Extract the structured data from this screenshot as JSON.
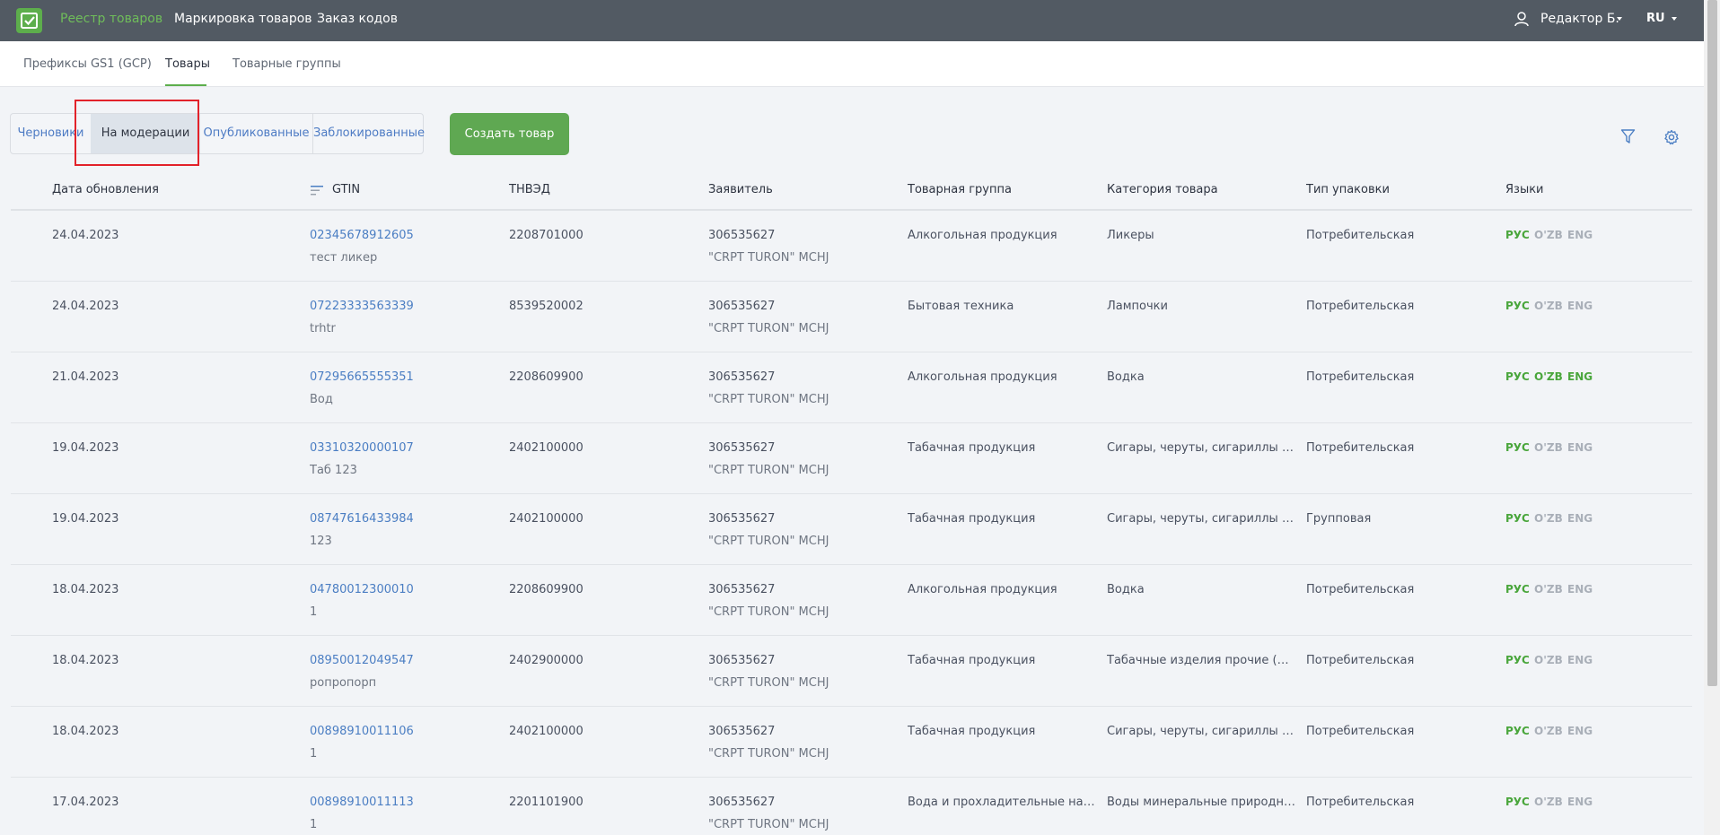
{
  "topbar": {
    "nav": [
      "Реестр товаров",
      "Маркировка товаров",
      "Заказ кодов"
    ],
    "user_name": "Редактор Б.",
    "language": "RU"
  },
  "subtabs": [
    "Префиксы GS1 (GCP)",
    "Товары",
    "Товарные группы"
  ],
  "filters": [
    "Черновики",
    "На модерации",
    "Опубликованные",
    "Заблокированные"
  ],
  "create_button": "Создать товар",
  "table": {
    "columns": [
      "Дата обновления",
      "GTIN",
      "ТНВЭД",
      "Заявитель",
      "Товарная группа",
      "Категория товара",
      "Тип упаковки",
      "Языки"
    ],
    "lang_labels": [
      "РУС",
      "O'ZB",
      "ENG"
    ],
    "rows": [
      {
        "date": "24.04.2023",
        "gtin": "02345678912605",
        "name": "тест ликер",
        "tnved": "2208701000",
        "inn": "306535627",
        "company": "\"CRPT TURON\" MCHJ",
        "group": "Алкогольная продукция",
        "category": "Ликеры",
        "package": "Потребительская",
        "langs": [
          true,
          false,
          false
        ]
      },
      {
        "date": "24.04.2023",
        "gtin": "07223333563339",
        "name": "trhtr",
        "tnved": "8539520002",
        "inn": "306535627",
        "company": "\"CRPT TURON\" MCHJ",
        "group": "Бытовая техника",
        "category": "Лампочки",
        "package": "Потребительская",
        "langs": [
          true,
          false,
          false
        ]
      },
      {
        "date": "21.04.2023",
        "gtin": "07295665555351",
        "name": "Вод",
        "tnved": "2208609900",
        "inn": "306535627",
        "company": "\"CRPT TURON\" MCHJ",
        "group": "Алкогольная продукция",
        "category": "Водка",
        "package": "Потребительская",
        "langs": [
          true,
          true,
          true
        ]
      },
      {
        "date": "19.04.2023",
        "gtin": "03310320000107",
        "name": "Таб 123",
        "tnved": "2402100000",
        "inn": "306535627",
        "company": "\"CRPT TURON\" MCHJ",
        "group": "Табачная продукция",
        "category": "Сигары, черуты, сигариллы (со...",
        "package": "Потребительская",
        "langs": [
          true,
          false,
          false
        ]
      },
      {
        "date": "19.04.2023",
        "gtin": "08747616433984",
        "name": "123",
        "tnved": "2402100000",
        "inn": "306535627",
        "company": "\"CRPT TURON\" MCHJ",
        "group": "Табачная продукция",
        "category": "Сигары, черуты, сигариллы (со...",
        "package": "Групповая",
        "langs": [
          true,
          false,
          false
        ]
      },
      {
        "date": "18.04.2023",
        "gtin": "04780012300010",
        "name": "1",
        "tnved": "2208609900",
        "inn": "306535627",
        "company": "\"CRPT TURON\" MCHJ",
        "group": "Алкогольная продукция",
        "category": "Водка",
        "package": "Потребительская",
        "langs": [
          true,
          false,
          false
        ]
      },
      {
        "date": "18.04.2023",
        "gtin": "08950012049547",
        "name": "ропропорп",
        "tnved": "2402900000",
        "inn": "306535627",
        "company": "\"CRPT TURON\" MCHJ",
        "group": "Табачная продукция",
        "category": "Табачные изделия прочие (из т...",
        "package": "Потребительская",
        "langs": [
          true,
          false,
          false
        ]
      },
      {
        "date": "18.04.2023",
        "gtin": "00898910011106",
        "name": "1",
        "tnved": "2402100000",
        "inn": "306535627",
        "company": "\"CRPT TURON\" MCHJ",
        "group": "Табачная продукция",
        "category": "Сигары, черуты, сигариллы (со...",
        "package": "Потребительская",
        "langs": [
          true,
          false,
          false
        ]
      },
      {
        "date": "17.04.2023",
        "gtin": "00898910011113",
        "name": "1",
        "tnved": "2201101900",
        "inn": "306535627",
        "company": "\"CRPT TURON\" MCHJ",
        "group": "Вода и прохладительные напит...",
        "category": "Воды минеральные природные...",
        "package": "Потребительская",
        "langs": [
          true,
          false,
          false
        ]
      }
    ]
  },
  "colors": {
    "topbar": "#525a63",
    "accent_green": "#5dae4c",
    "link_blue": "#4b7ec3",
    "highlight_red": "#e2222a"
  }
}
